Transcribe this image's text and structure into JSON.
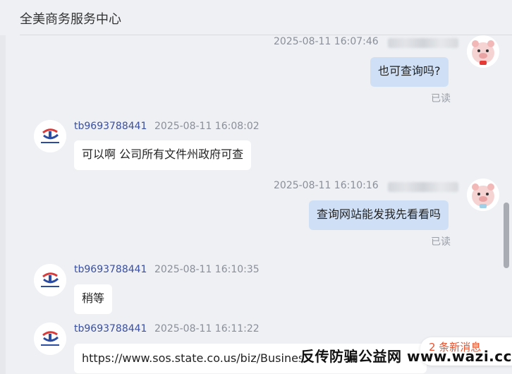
{
  "header": {
    "title": "全美商务服务中心"
  },
  "messages": [
    {
      "direction": "out",
      "timestamp": "2025-08-11 16:07:46",
      "text": "也可查询吗?",
      "status": "已读"
    },
    {
      "direction": "in",
      "sender": "tb9693788441",
      "timestamp": "2025-08-11 16:08:02",
      "text": "可以啊 公司所有文件州政府可查"
    },
    {
      "direction": "out",
      "timestamp": "2025-08-11 16:10:16",
      "text": "查询网站能发我先看看吗",
      "status": "已读"
    },
    {
      "direction": "in",
      "sender": "tb9693788441",
      "timestamp": "2025-08-11 16:10:35",
      "text": "稍等"
    },
    {
      "direction": "in",
      "sender": "tb9693788441",
      "timestamp": "2025-08-11 16:11:22",
      "text": "https://www.sos.state.co.us/biz/Busines"
    }
  ],
  "new_messages": "2 条新消息",
  "watermark": "反传防骗公益网 www.wazi.cc",
  "colors": {
    "outgoing_bubble": "#cfe0f6",
    "incoming_bubble": "#ffffff",
    "sender_name": "#3a4fa0",
    "new_msg_accent": "#e7522f"
  }
}
